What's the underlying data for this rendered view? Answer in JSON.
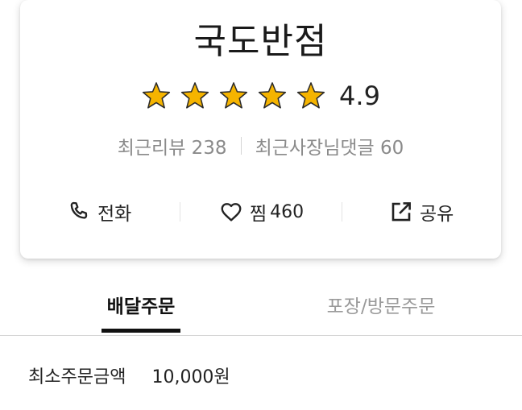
{
  "store": {
    "name": "국도반점",
    "rating": {
      "value": "4.9",
      "stars_filled": 5,
      "stars_total": 5,
      "star_color": "#F5B400"
    },
    "reviews": {
      "recent_reviews": "최근리뷰 238",
      "owner_replies": "최근사장님댓글 60"
    }
  },
  "actions": {
    "call_label": "전화",
    "favorite_label": "찜",
    "favorite_count": "460",
    "share_label": "공유"
  },
  "tabs": [
    {
      "label": "배달주문",
      "active": true
    },
    {
      "label": "포장/방문주문",
      "active": false
    }
  ],
  "order_info": {
    "min_order_label": "최소주문금액",
    "min_order_value": "10,000원"
  },
  "icons": [
    "star-icon",
    "phone-icon",
    "heart-icon",
    "share-icon"
  ]
}
